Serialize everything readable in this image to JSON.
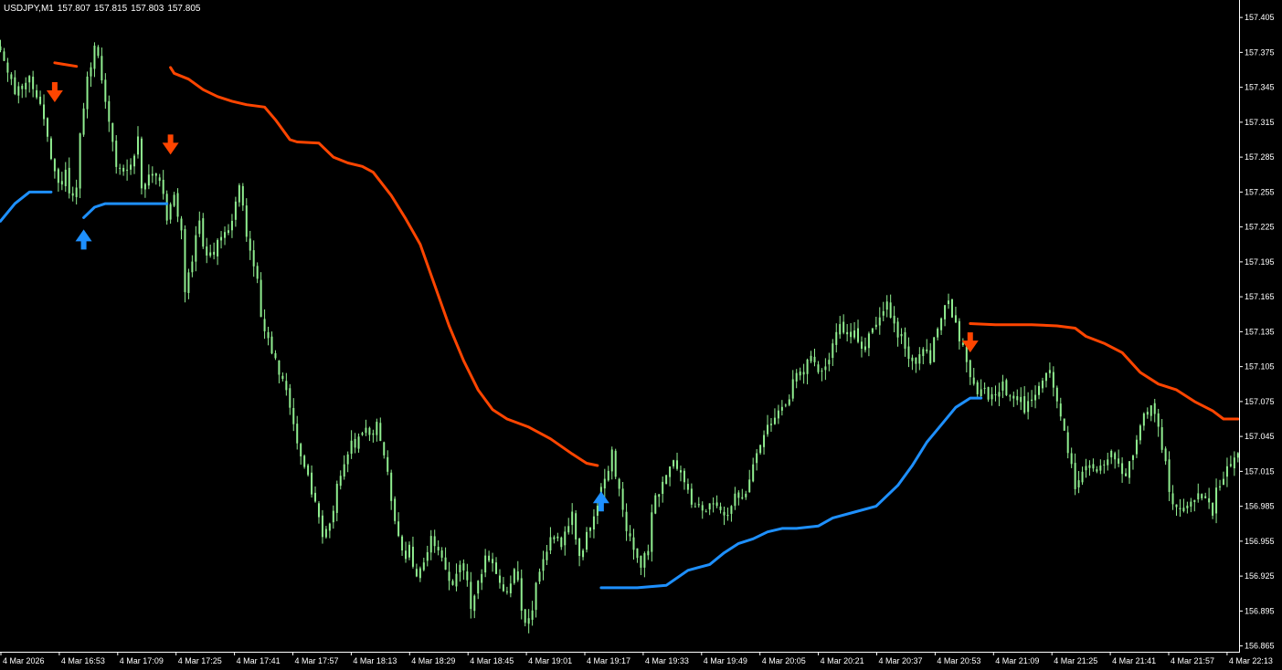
{
  "header": {
    "symbol": "USDJPY,M1",
    "open": "157.807",
    "high": "157.815",
    "low": "157.803",
    "close": "157.805"
  },
  "colors": {
    "background": "#000000",
    "candle": "#90EE90",
    "upper_band": "#FF4500",
    "lower_band": "#1E90FF",
    "sell_arrow": "#FF4500",
    "buy_arrow": "#1E90FF",
    "axis": "#FFFFFF"
  },
  "chart_data": {
    "type": "candlestick",
    "symbol": "USDJPY",
    "timeframe": "M1",
    "ylim": [
      156.86,
      157.42
    ],
    "y_ticks": [
      "157.405",
      "157.375",
      "157.345",
      "157.315",
      "157.285",
      "157.255",
      "157.225",
      "157.195",
      "157.165",
      "157.135",
      "157.105",
      "157.075",
      "157.045",
      "157.015",
      "156.985",
      "156.955",
      "156.925",
      "156.895",
      "156.865"
    ],
    "x_ticks": [
      "4 Mar 2026",
      "4 Mar 16:53",
      "4 Mar 17:09",
      "4 Mar 17:25",
      "4 Mar 17:41",
      "4 Mar 17:57",
      "4 Mar 18:13",
      "4 Mar 18:29",
      "4 Mar 18:45",
      "4 Mar 19:01",
      "4 Mar 19:17",
      "4 Mar 19:33",
      "4 Mar 19:49",
      "4 Mar 20:05",
      "4 Mar 20:21",
      "4 Mar 20:37",
      "4 Mar 20:53",
      "4 Mar 21:09",
      "4 Mar 21:25",
      "4 Mar 21:41",
      "4 Mar 21:57",
      "4 Mar 22:13"
    ],
    "close_path": [
      [
        0,
        157.38
      ],
      [
        4,
        157.34
      ],
      [
        8,
        157.35
      ],
      [
        12,
        157.32
      ],
      [
        14,
        157.28
      ],
      [
        16,
        157.26
      ],
      [
        18,
        157.27
      ],
      [
        19,
        157.25
      ],
      [
        21,
        157.26
      ],
      [
        22,
        157.31
      ],
      [
        24,
        157.35
      ],
      [
        26,
        157.38
      ],
      [
        27,
        157.37
      ],
      [
        29,
        157.33
      ],
      [
        31,
        157.3
      ],
      [
        32,
        157.28
      ],
      [
        34,
        157.27
      ],
      [
        36,
        157.28
      ],
      [
        38,
        157.3
      ],
      [
        39,
        157.26
      ],
      [
        41,
        157.27
      ],
      [
        43,
        157.27
      ],
      [
        45,
        157.25
      ],
      [
        46,
        157.23
      ],
      [
        48,
        157.25
      ],
      [
        50,
        157.22
      ],
      [
        51,
        157.17
      ],
      [
        53,
        157.2
      ],
      [
        55,
        157.23
      ],
      [
        56,
        157.21
      ],
      [
        58,
        157.2
      ],
      [
        60,
        157.21
      ],
      [
        62,
        157.22
      ],
      [
        64,
        157.23
      ],
      [
        66,
        157.26
      ],
      [
        67,
        157.24
      ],
      [
        69,
        157.2
      ],
      [
        71,
        157.18
      ],
      [
        72,
        157.15
      ],
      [
        74,
        157.13
      ],
      [
        76,
        157.11
      ],
      [
        78,
        157.09
      ],
      [
        80,
        157.07
      ],
      [
        82,
        157.04
      ],
      [
        84,
        157.02
      ],
      [
        86,
        157.0
      ],
      [
        88,
        156.98
      ],
      [
        89,
        156.96
      ],
      [
        91,
        156.97
      ],
      [
        93,
        157.0
      ],
      [
        95,
        157.02
      ],
      [
        97,
        157.04
      ],
      [
        99,
        157.04
      ],
      [
        101,
        157.05
      ],
      [
        103,
        157.05
      ],
      [
        104,
        157.06
      ],
      [
        106,
        157.03
      ],
      [
        108,
        156.99
      ],
      [
        110,
        156.96
      ],
      [
        112,
        156.94
      ],
      [
        113,
        156.95
      ],
      [
        115,
        156.92
      ],
      [
        117,
        156.94
      ],
      [
        119,
        156.96
      ],
      [
        121,
        156.95
      ],
      [
        123,
        156.93
      ],
      [
        125,
        156.92
      ],
      [
        127,
        156.93
      ],
      [
        129,
        156.92
      ],
      [
        130,
        156.9
      ],
      [
        132,
        156.92
      ],
      [
        134,
        156.94
      ],
      [
        136,
        156.94
      ],
      [
        138,
        156.92
      ],
      [
        140,
        156.91
      ],
      [
        142,
        156.93
      ],
      [
        143,
        156.92
      ],
      [
        145,
        156.88
      ],
      [
        147,
        156.9
      ],
      [
        149,
        156.93
      ],
      [
        151,
        156.95
      ],
      [
        153,
        156.96
      ],
      [
        155,
        156.95
      ],
      [
        156,
        156.96
      ],
      [
        158,
        156.98
      ],
      [
        160,
        156.94
      ],
      [
        162,
        156.96
      ],
      [
        164,
        156.98
      ],
      [
        166,
        157.0
      ],
      [
        168,
        157.02
      ],
      [
        169,
        157.03
      ],
      [
        171,
        157.0
      ],
      [
        173,
        156.96
      ],
      [
        175,
        156.95
      ],
      [
        177,
        156.93
      ],
      [
        179,
        156.95
      ],
      [
        180,
        156.98
      ],
      [
        182,
        157.0
      ],
      [
        184,
        157.01
      ],
      [
        186,
        157.02
      ],
      [
        188,
        157.01
      ],
      [
        190,
        157.0
      ],
      [
        192,
        156.98
      ],
      [
        193,
        156.99
      ],
      [
        195,
        156.98
      ],
      [
        197,
        156.99
      ],
      [
        199,
        156.98
      ],
      [
        201,
        156.98
      ],
      [
        203,
        157.0
      ],
      [
        205,
        156.99
      ],
      [
        206,
        157.0
      ],
      [
        208,
        157.02
      ],
      [
        210,
        157.04
      ],
      [
        212,
        157.05
      ],
      [
        214,
        157.06
      ],
      [
        216,
        157.07
      ],
      [
        218,
        157.08
      ],
      [
        219,
        157.09
      ],
      [
        221,
        157.1
      ],
      [
        223,
        157.11
      ],
      [
        225,
        157.11
      ],
      [
        227,
        157.1
      ],
      [
        229,
        157.11
      ],
      [
        231,
        157.13
      ],
      [
        232,
        157.14
      ],
      [
        234,
        157.13
      ],
      [
        236,
        157.14
      ],
      [
        238,
        157.12
      ],
      [
        240,
        157.13
      ],
      [
        242,
        157.14
      ],
      [
        244,
        157.15
      ],
      [
        245,
        157.16
      ],
      [
        247,
        157.14
      ],
      [
        249,
        157.13
      ],
      [
        251,
        157.11
      ],
      [
        253,
        157.11
      ],
      [
        255,
        157.12
      ],
      [
        257,
        157.11
      ],
      [
        258,
        157.13
      ],
      [
        260,
        157.15
      ],
      [
        262,
        157.16
      ],
      [
        264,
        157.14
      ],
      [
        266,
        157.12
      ],
      [
        268,
        157.1
      ],
      [
        270,
        157.08
      ],
      [
        271,
        157.09
      ],
      [
        273,
        157.08
      ],
      [
        275,
        157.08
      ],
      [
        277,
        157.09
      ],
      [
        279,
        157.08
      ],
      [
        281,
        157.08
      ],
      [
        283,
        157.07
      ],
      [
        285,
        157.08
      ],
      [
        286,
        157.08
      ],
      [
        288,
        157.09
      ],
      [
        290,
        157.1
      ],
      [
        292,
        157.08
      ],
      [
        294,
        157.05
      ],
      [
        296,
        157.02
      ],
      [
        297,
        157.0
      ],
      [
        299,
        157.01
      ],
      [
        301,
        157.02
      ],
      [
        303,
        157.01
      ],
      [
        305,
        157.02
      ],
      [
        307,
        157.03
      ],
      [
        309,
        157.02
      ],
      [
        310,
        157.01
      ],
      [
        312,
        157.02
      ],
      [
        314,
        157.04
      ],
      [
        316,
        157.06
      ],
      [
        318,
        157.07
      ],
      [
        320,
        157.05
      ],
      [
        322,
        157.02
      ],
      [
        323,
        157.0
      ],
      [
        325,
        156.98
      ],
      [
        327,
        156.98
      ],
      [
        329,
        156.99
      ],
      [
        331,
        157.0
      ],
      [
        333,
        156.99
      ],
      [
        335,
        156.98
      ],
      [
        336,
        157.0
      ],
      [
        338,
        157.01
      ],
      [
        340,
        157.02
      ],
      [
        342,
        157.03
      ]
    ],
    "series": [
      {
        "name": "upper_band",
        "segments": [
          [
            [
              15,
              157.366
            ],
            [
              17,
              157.365
            ],
            [
              21,
              157.363
            ]
          ],
          [
            [
              47,
              157.362
            ],
            [
              48,
              157.357
            ],
            [
              52,
              157.352
            ],
            [
              56,
              157.343
            ],
            [
              60,
              157.337
            ],
            [
              64,
              157.333
            ],
            [
              68,
              157.33
            ],
            [
              73,
              157.328
            ],
            [
              76,
              157.317
            ],
            [
              80,
              157.3
            ],
            [
              82,
              157.298
            ],
            [
              88,
              157.297
            ],
            [
              92,
              157.285
            ],
            [
              96,
              157.28
            ],
            [
              100,
              157.277
            ],
            [
              103,
              157.272
            ],
            [
              108,
              157.252
            ],
            [
              112,
              157.232
            ],
            [
              116,
              157.21
            ],
            [
              120,
              157.175
            ],
            [
              124,
              157.14
            ],
            [
              128,
              157.11
            ],
            [
              132,
              157.085
            ],
            [
              136,
              157.068
            ],
            [
              140,
              157.06
            ],
            [
              146,
              157.053
            ],
            [
              152,
              157.043
            ],
            [
              158,
              157.03
            ],
            [
              162,
              157.022
            ],
            [
              165,
              157.02
            ]
          ],
          [
            [
              268,
              157.142
            ],
            [
              275,
              157.141
            ],
            [
              285,
              157.141
            ],
            [
              292,
              157.14
            ],
            [
              297,
              157.138
            ],
            [
              300,
              157.131
            ],
            [
              305,
              157.125
            ],
            [
              310,
              157.117
            ],
            [
              315,
              157.1
            ],
            [
              320,
              157.09
            ],
            [
              325,
              157.085
            ],
            [
              330,
              157.075
            ],
            [
              335,
              157.067
            ],
            [
              338,
              157.06
            ],
            [
              342,
              157.06
            ]
          ]
        ]
      },
      {
        "name": "lower_band",
        "segments": [
          [
            [
              0,
              157.23
            ],
            [
              4,
              157.245
            ],
            [
              8,
              157.255
            ],
            [
              14,
              157.255
            ]
          ],
          [
            [
              23,
              157.233
            ],
            [
              26,
              157.242
            ],
            [
              29,
              157.245
            ],
            [
              46,
              157.245
            ]
          ],
          [
            [
              166,
              156.915
            ],
            [
              176,
              156.915
            ],
            [
              184,
              156.917
            ],
            [
              190,
              156.93
            ],
            [
              196,
              156.935
            ],
            [
              200,
              156.945
            ],
            [
              204,
              156.953
            ],
            [
              208,
              156.957
            ],
            [
              212,
              156.963
            ],
            [
              216,
              156.966
            ],
            [
              220,
              156.966
            ],
            [
              226,
              156.968
            ],
            [
              230,
              156.975
            ],
            [
              236,
              156.98
            ],
            [
              242,
              156.985
            ],
            [
              248,
              157.003
            ],
            [
              252,
              157.02
            ],
            [
              256,
              157.04
            ],
            [
              260,
              157.055
            ],
            [
              264,
              157.07
            ],
            [
              268,
              157.078
            ],
            [
              271,
              157.078
            ]
          ]
        ]
      }
    ],
    "signals": [
      {
        "type": "sell",
        "i": 15,
        "price": 157.34
      },
      {
        "type": "sell",
        "i": 47,
        "price": 157.295
      },
      {
        "type": "buy",
        "i": 23,
        "price": 157.215
      },
      {
        "type": "buy",
        "i": 166,
        "price": 156.99
      },
      {
        "type": "sell",
        "i": 268,
        "price": 157.125
      }
    ]
  }
}
